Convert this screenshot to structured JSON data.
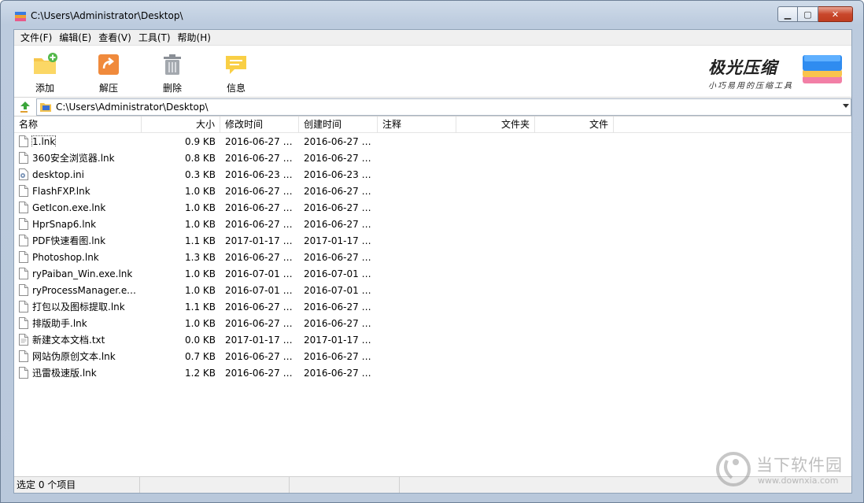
{
  "window": {
    "title": "C:\\Users\\Administrator\\Desktop\\"
  },
  "menu": [
    {
      "label": "文件(F)"
    },
    {
      "label": "编辑(E)"
    },
    {
      "label": "查看(V)"
    },
    {
      "label": "工具(T)"
    },
    {
      "label": "帮助(H)"
    }
  ],
  "toolbar": {
    "add_label": "添加",
    "extract_label": "解压",
    "delete_label": "删除",
    "info_label": "信息"
  },
  "brand": {
    "title": "极光压缩",
    "subtitle": "小巧易用的压缩工具"
  },
  "address": {
    "path": "C:\\Users\\Administrator\\Desktop\\"
  },
  "columns": {
    "name": "名称",
    "size": "大小",
    "modified": "修改时间",
    "created": "创建时间",
    "comment": "注释",
    "folders": "文件夹",
    "files": "文件"
  },
  "files": [
    {
      "name": "1.lnk",
      "size": "0.9 KB",
      "modified": "2016-06-27 0...",
      "created": "2016-06-27 0...",
      "icon": "file-icon"
    },
    {
      "name": "360安全浏览器.lnk",
      "size": "0.8 KB",
      "modified": "2016-06-27 0...",
      "created": "2016-06-27 0...",
      "icon": "file-icon"
    },
    {
      "name": "desktop.ini",
      "size": "0.3 KB",
      "modified": "2016-06-23 1...",
      "created": "2016-06-23 1...",
      "icon": "settings-file-icon"
    },
    {
      "name": "FlashFXP.lnk",
      "size": "1.0 KB",
      "modified": "2016-06-27 0...",
      "created": "2016-06-27 0...",
      "icon": "file-icon"
    },
    {
      "name": "GetIcon.exe.lnk",
      "size": "1.0 KB",
      "modified": "2016-06-27 1...",
      "created": "2016-06-27 1...",
      "icon": "file-icon"
    },
    {
      "name": "HprSnap6.lnk",
      "size": "1.0 KB",
      "modified": "2016-06-27 0...",
      "created": "2016-06-27 0...",
      "icon": "file-icon"
    },
    {
      "name": "PDF快速看图.lnk",
      "size": "1.1 KB",
      "modified": "2017-01-17 0...",
      "created": "2017-01-17 0...",
      "icon": "file-icon"
    },
    {
      "name": "Photoshop.lnk",
      "size": "1.3 KB",
      "modified": "2016-06-27 1...",
      "created": "2016-06-27 1...",
      "icon": "file-icon"
    },
    {
      "name": "ryPaiban_Win.exe.lnk",
      "size": "1.0 KB",
      "modified": "2016-07-01 0...",
      "created": "2016-07-01 0...",
      "icon": "file-icon"
    },
    {
      "name": "ryProcessManager.ex...",
      "size": "1.0 KB",
      "modified": "2016-07-01 0...",
      "created": "2016-07-01 0...",
      "icon": "file-icon"
    },
    {
      "name": "打包以及图标提取.lnk",
      "size": "1.1 KB",
      "modified": "2016-06-27 0...",
      "created": "2016-06-27 0...",
      "icon": "file-icon"
    },
    {
      "name": "排版助手.lnk",
      "size": "1.0 KB",
      "modified": "2016-06-27 0...",
      "created": "2016-06-27 0...",
      "icon": "file-icon"
    },
    {
      "name": "新建文本文档.txt",
      "size": "0.0 KB",
      "modified": "2017-01-17 0...",
      "created": "2017-01-17 0...",
      "icon": "text-file-icon"
    },
    {
      "name": "网站伪原创文本.lnk",
      "size": "0.7 KB",
      "modified": "2016-06-27 1...",
      "created": "2016-06-27 1...",
      "icon": "file-icon"
    },
    {
      "name": "迅雷极速版.lnk",
      "size": "1.2 KB",
      "modified": "2016-06-27 0...",
      "created": "2016-06-27 0...",
      "icon": "file-icon"
    }
  ],
  "status": {
    "selected": "选定 0 个项目"
  },
  "watermark": {
    "text": "当下软件园",
    "url": "www.downxia.com"
  }
}
